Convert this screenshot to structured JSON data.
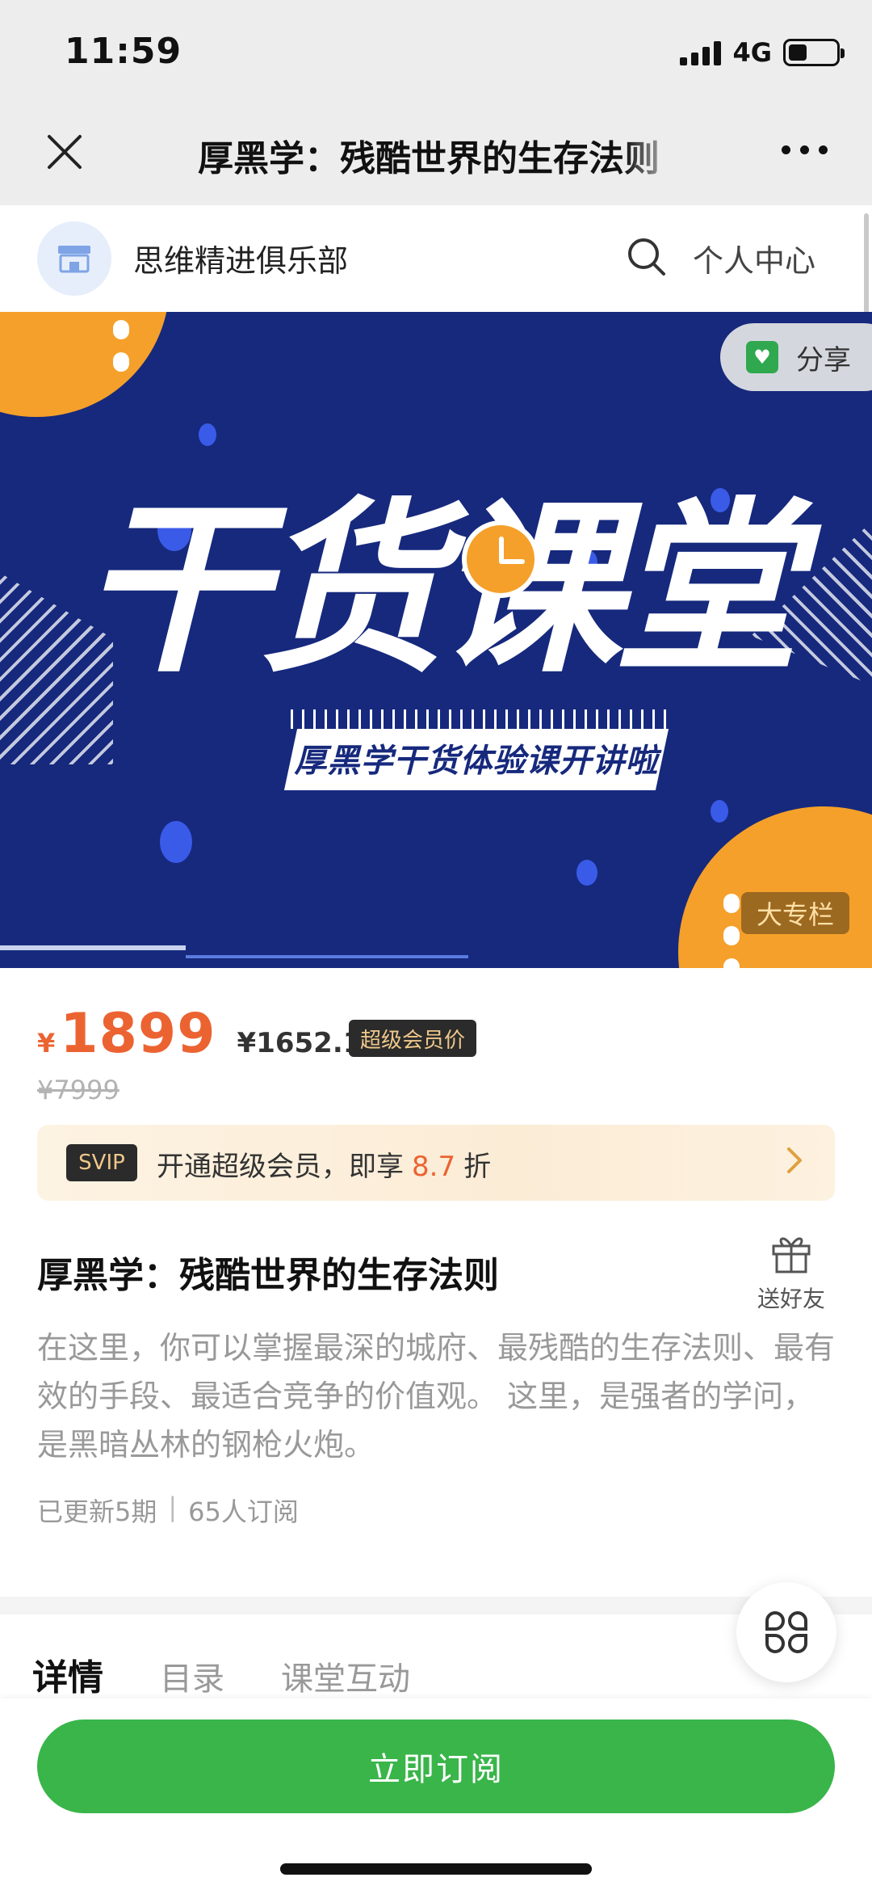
{
  "status_bar": {
    "time": "11:59",
    "network": "4G",
    "battery_level": 0.4
  },
  "nav": {
    "title": "厚黑学：残酷世界的生存法则",
    "close_icon": "close-icon",
    "more_icon": "more-icon"
  },
  "shop": {
    "name": "思维精进俱乐部",
    "personal_center": "个人中心",
    "search_icon": "search-icon"
  },
  "banner": {
    "big_text": "干货课堂",
    "sub_text": "厚黑学干货体验课开讲啦",
    "share_label": "分享",
    "tag": "大专栏"
  },
  "price": {
    "currency": "¥",
    "current": "1899",
    "member_price": "¥1652.13",
    "member_badge": "超级会员价",
    "original": "¥7999"
  },
  "svip": {
    "tag": "SVIP",
    "text_prefix": "开通超级会员，即享",
    "discount": "8.7",
    "text_suffix": "折"
  },
  "course": {
    "title": "厚黑学：残酷世界的生存法则",
    "gift_label": "送好友",
    "description": "在这里，你可以掌握最深的城府、最残酷的生存法则、最有效的手段、最适合竞争的价值观。 这里，是强者的学问，是黑暗丛林的钢枪火炮。",
    "updates": "已更新5期",
    "subscribers": "65人订阅"
  },
  "tabs": [
    {
      "label": "详情",
      "active": true
    },
    {
      "label": "目录",
      "active": false
    },
    {
      "label": "课堂互动",
      "active": false
    }
  ],
  "subscribe_button": "立即订阅",
  "colors": {
    "accent_green": "#39b54a",
    "price_orange": "#ec6332",
    "banner_blue": "#16297d",
    "banner_orange": "#f5a02a"
  }
}
